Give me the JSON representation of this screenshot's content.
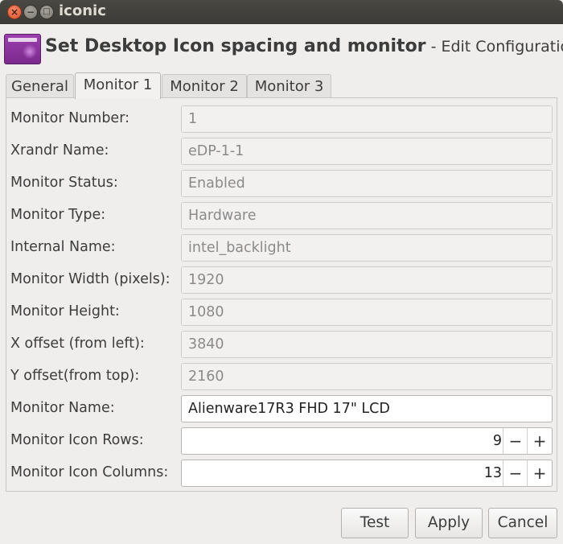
{
  "window": {
    "title": "iconic",
    "close_glyph": "×",
    "minimize_glyph": "−",
    "maximize_glyph": "□"
  },
  "header": {
    "title": "Set Desktop Icon spacing and monitor",
    "subtitle": " - Edit Configuration",
    "icon": "app-window-icon"
  },
  "tabs": [
    {
      "label": "General",
      "active": false
    },
    {
      "label": "Monitor 1",
      "active": true
    },
    {
      "label": "Monitor 2",
      "active": false
    },
    {
      "label": "Monitor 3",
      "active": false
    }
  ],
  "fields": [
    {
      "label": "Monitor Number:",
      "value": "1"
    },
    {
      "label": "Xrandr Name:",
      "value": "eDP-1-1"
    },
    {
      "label": "Monitor Status:",
      "value": "Enabled"
    },
    {
      "label": "Monitor Type:",
      "value": "Hardware"
    },
    {
      "label": "Internal Name:",
      "value": "intel_backlight"
    },
    {
      "label": "Monitor Width (pixels):",
      "value": "1920"
    },
    {
      "label": "Monitor Height:",
      "value": "1080"
    },
    {
      "label": "X offset (from left):",
      "value": "3840"
    },
    {
      "label": "Y offset(from top):",
      "value": "2160"
    }
  ],
  "monitor_name": {
    "label": "Monitor Name:",
    "value": "Alienware17R3 FHD 17\" LCD"
  },
  "icon_rows": {
    "label": "Monitor Icon Rows:",
    "value": "9"
  },
  "icon_columns": {
    "label": "Monitor Icon Columns:",
    "value": "13"
  },
  "spin": {
    "minus": "−",
    "plus": "+"
  },
  "buttons": {
    "test": "Test",
    "apply": "Apply",
    "cancel": "Cancel"
  }
}
